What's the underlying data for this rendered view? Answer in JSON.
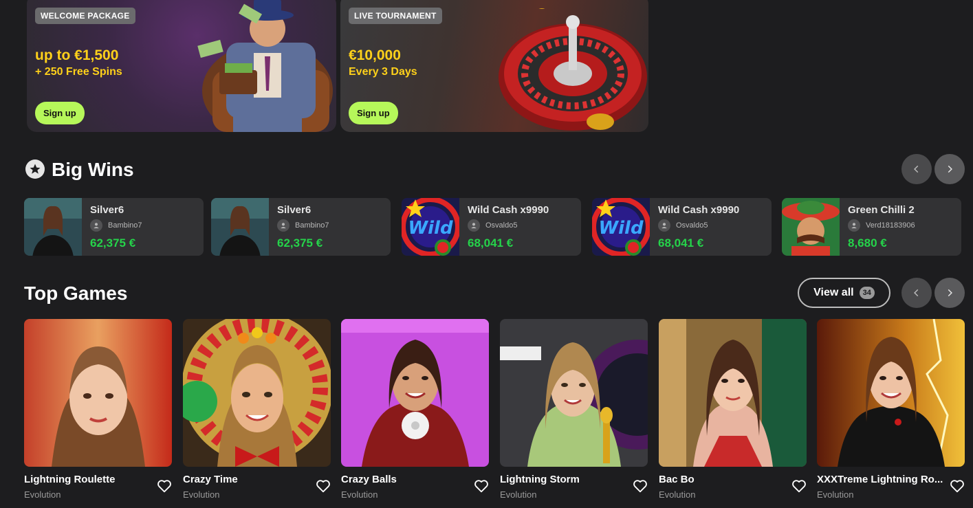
{
  "promos": [
    {
      "tag": "WELCOME PACKAGE",
      "amount": "up to €1,500",
      "sub": "+ 250 Free Spins",
      "button": "Sign up"
    },
    {
      "tag": "LIVE TOURNAMENT",
      "amount": "€10,000",
      "sub": "Every 3 Days",
      "button": "Sign up"
    }
  ],
  "big_wins": {
    "title": "Big Wins",
    "items": [
      {
        "game": "Silver6",
        "user": "Bambino7",
        "prize": "62,375 €"
      },
      {
        "game": "Silver6",
        "user": "Bambino7",
        "prize": "62,375 €"
      },
      {
        "game": "Wild Cash x9990",
        "user": "Osvaldo5",
        "prize": "68,041 €"
      },
      {
        "game": "Wild Cash x9990",
        "user": "Osvaldo5",
        "prize": "68,041 €"
      },
      {
        "game": "Green Chilli 2",
        "user": "Verd18183906",
        "prize": "8,680 €"
      }
    ]
  },
  "top_games": {
    "title": "Top Games",
    "view_all": "View all",
    "count": "34",
    "items": [
      {
        "name": "Lightning Roulette",
        "provider": "Evolution"
      },
      {
        "name": "Crazy Time",
        "provider": "Evolution"
      },
      {
        "name": "Crazy Balls",
        "provider": "Evolution"
      },
      {
        "name": "Lightning Storm",
        "provider": "Evolution"
      },
      {
        "name": "Bac Bo",
        "provider": "Evolution"
      },
      {
        "name": "XXXTreme Lightning Ro...",
        "provider": "Evolution"
      }
    ]
  },
  "colors": {
    "accent_green": "#b6f75a",
    "prize_green": "#25d34a",
    "promo_yellow": "#ffd11a",
    "background": "#1d1d1f"
  }
}
